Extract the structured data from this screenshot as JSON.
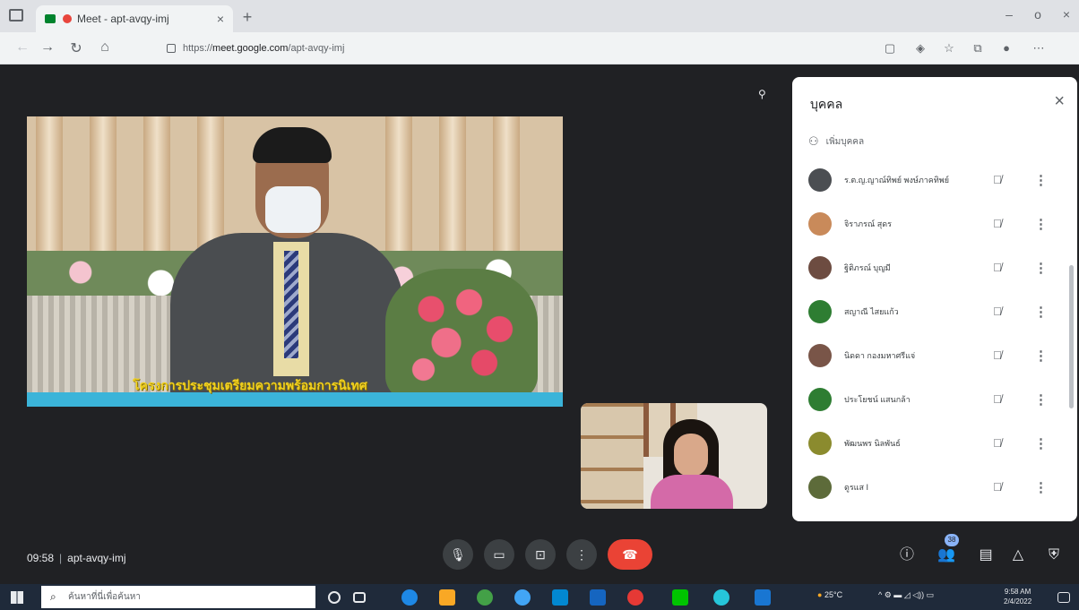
{
  "browser": {
    "tab_title": "Meet - apt-avqy-imj",
    "tab_close": "×",
    "new_tab": "+",
    "url_prefix": "https://",
    "url_host": "meet.google.com",
    "url_path": "/apt-avqy-imj",
    "window_controls": [
      "–",
      "o",
      "×"
    ]
  },
  "panel": {
    "title": "บุคคล",
    "close": "×",
    "add_people": "เพิ่มบุคคล",
    "participants": [
      {
        "name": "ร.ต.ญ.ญาณ์ทิพย์ พงษ์ภาคทิพย์",
        "avatar_color": "#4b4e52"
      },
      {
        "name": "จิราภรณ์ สุดร",
        "avatar_color": "#c98a5a"
      },
      {
        "name": "ฐิติภรณ์ บุญมี",
        "avatar_color": "#6d4c41"
      },
      {
        "name": "สญาณี ไสยแก้ว",
        "avatar_color": "#2e7d32"
      },
      {
        "name": "นิดดา กองมหาศรีแจ่",
        "avatar_color": "#795548"
      },
      {
        "name": "ประโยชน์ แสนกล้า",
        "avatar_color": "#2e7d32"
      },
      {
        "name": "พัฒนพร นิลพันธ์",
        "avatar_color": "#8b8b2e"
      },
      {
        "name": "ดูรแส I",
        "avatar_color": "#5d6b3a"
      }
    ]
  },
  "meeting": {
    "time": "09:58",
    "separator": "|",
    "code": "apt-avqy-imj",
    "participant_count": "38",
    "banner_caption": "โครงการประชุมเตรียมความพร้อมการนิเทศ"
  },
  "taskbar": {
    "search_placeholder": "ค้นหาที่นี่เพื่อค้นหา",
    "weather": "25°C",
    "clock_time": "9:58 AM",
    "clock_date": "2/4/2022"
  },
  "icons": {
    "mic": "microphone-icon",
    "camera": "camera-icon",
    "present": "present-screen-icon",
    "more": "more-options-icon",
    "end_call": "end-call-icon",
    "info": "info-icon",
    "people": "people-icon",
    "chat": "chat-icon",
    "activities": "activities-icon",
    "host_controls": "host-controls-icon"
  },
  "colors": {
    "end_call": "#ea4335",
    "stage_bg": "#202124",
    "panel_bg": "#ffffff",
    "badge": "#8ab4f8"
  }
}
